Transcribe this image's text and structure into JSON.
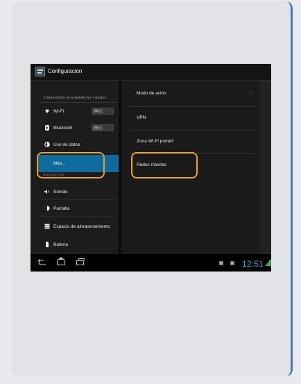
{
  "window": {
    "title": "Configuración"
  },
  "left_panel": {
    "section_wireless": "CONEXIONES INALÁMBRICAS Y REDES",
    "section_device": "DISPOSITIVO",
    "items": [
      {
        "id": "wifi",
        "label": "Wi-Fi",
        "icon": "wifi-icon",
        "toggle": "No"
      },
      {
        "id": "bluetooth",
        "label": "Bluetooth",
        "icon": "bluetooth-icon",
        "toggle": "No"
      },
      {
        "id": "data",
        "label": "Uso de datos",
        "icon": "data-usage-icon"
      },
      {
        "id": "more",
        "label": "Más...",
        "icon": "",
        "selected": true
      },
      {
        "id": "sound",
        "label": "Sonido",
        "icon": "volume-icon"
      },
      {
        "id": "display",
        "label": "Pantalla",
        "icon": "display-icon"
      },
      {
        "id": "storage",
        "label": "Espacio de almacenamiento",
        "icon": "storage-icon"
      },
      {
        "id": "battery",
        "label": "Batería",
        "icon": "battery-icon"
      }
    ]
  },
  "right_panel": {
    "items": [
      {
        "label": "Modo de avión",
        "checkbox": false
      },
      {
        "label": "VPN"
      },
      {
        "label": "Zona Wi-Fi portátil"
      },
      {
        "label": "Redes móviles"
      }
    ]
  },
  "system_bar": {
    "time": "12:51",
    "time_color": "#36a6d9",
    "nav": [
      "back-icon",
      "home-icon",
      "recent-apps-icon"
    ]
  },
  "colors": {
    "selected": "#0e6b9b",
    "highlight": "#f0a21a",
    "accent": "#2a7fd0"
  }
}
